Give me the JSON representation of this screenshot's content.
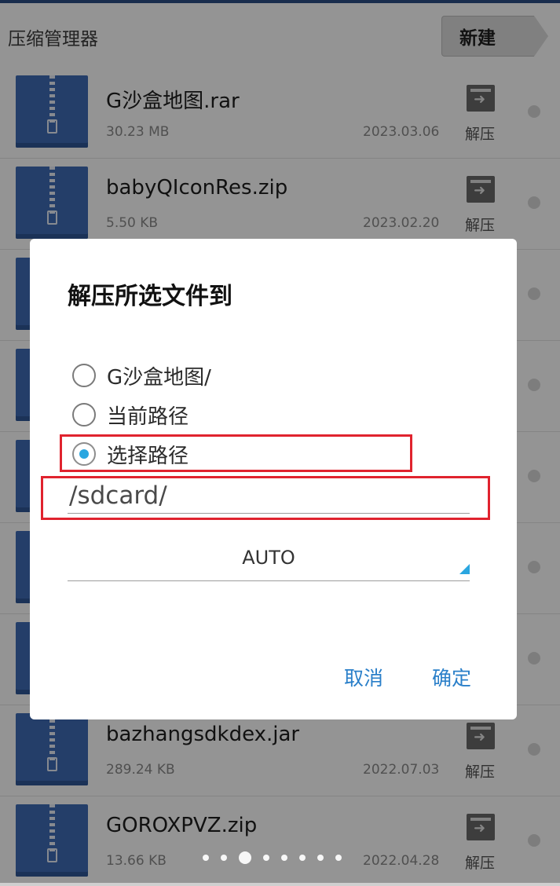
{
  "header": {
    "title": "压缩管理器",
    "new_button": "新建"
  },
  "files": [
    {
      "name": "G沙盒地图.rar",
      "size": "30.23 MB",
      "date": "2023.03.06",
      "action": "解压"
    },
    {
      "name": "babyQIconRes.zip",
      "size": "5.50 KB",
      "date": "2023.02.20",
      "action": "解压"
    },
    {
      "name": "",
      "size": "",
      "date": "",
      "action": ""
    },
    {
      "name": "",
      "size": "",
      "date": "",
      "action": ""
    },
    {
      "name": "",
      "size": "",
      "date": "",
      "action": ""
    },
    {
      "name": "",
      "size": "",
      "date": "",
      "action": ""
    },
    {
      "name": "",
      "size": "",
      "date": "",
      "action": ""
    },
    {
      "name": "bazhangsdkdex.jar",
      "size": "289.24 KB",
      "date": "2022.07.03",
      "action": "解压"
    },
    {
      "name": "GOROXPVZ.zip",
      "size": "13.66 KB",
      "date": "2022.04.28",
      "action": "解压"
    }
  ],
  "pager": {
    "count": 8,
    "active_index": 2
  },
  "dialog": {
    "title": "解压所选文件到",
    "options": [
      {
        "label": "G沙盒地图/",
        "checked": false
      },
      {
        "label": "当前路径",
        "checked": false
      },
      {
        "label": "选择路径",
        "checked": true
      }
    ],
    "path_value": "/sdcard/",
    "encoding_value": "AUTO",
    "cancel_label": "取消",
    "confirm_label": "确定"
  },
  "colors": {
    "accent": "#2aa6e0",
    "button_text": "#2a7fc9",
    "zip_icon": "#3e6bb5",
    "highlight": "#e0232e"
  }
}
